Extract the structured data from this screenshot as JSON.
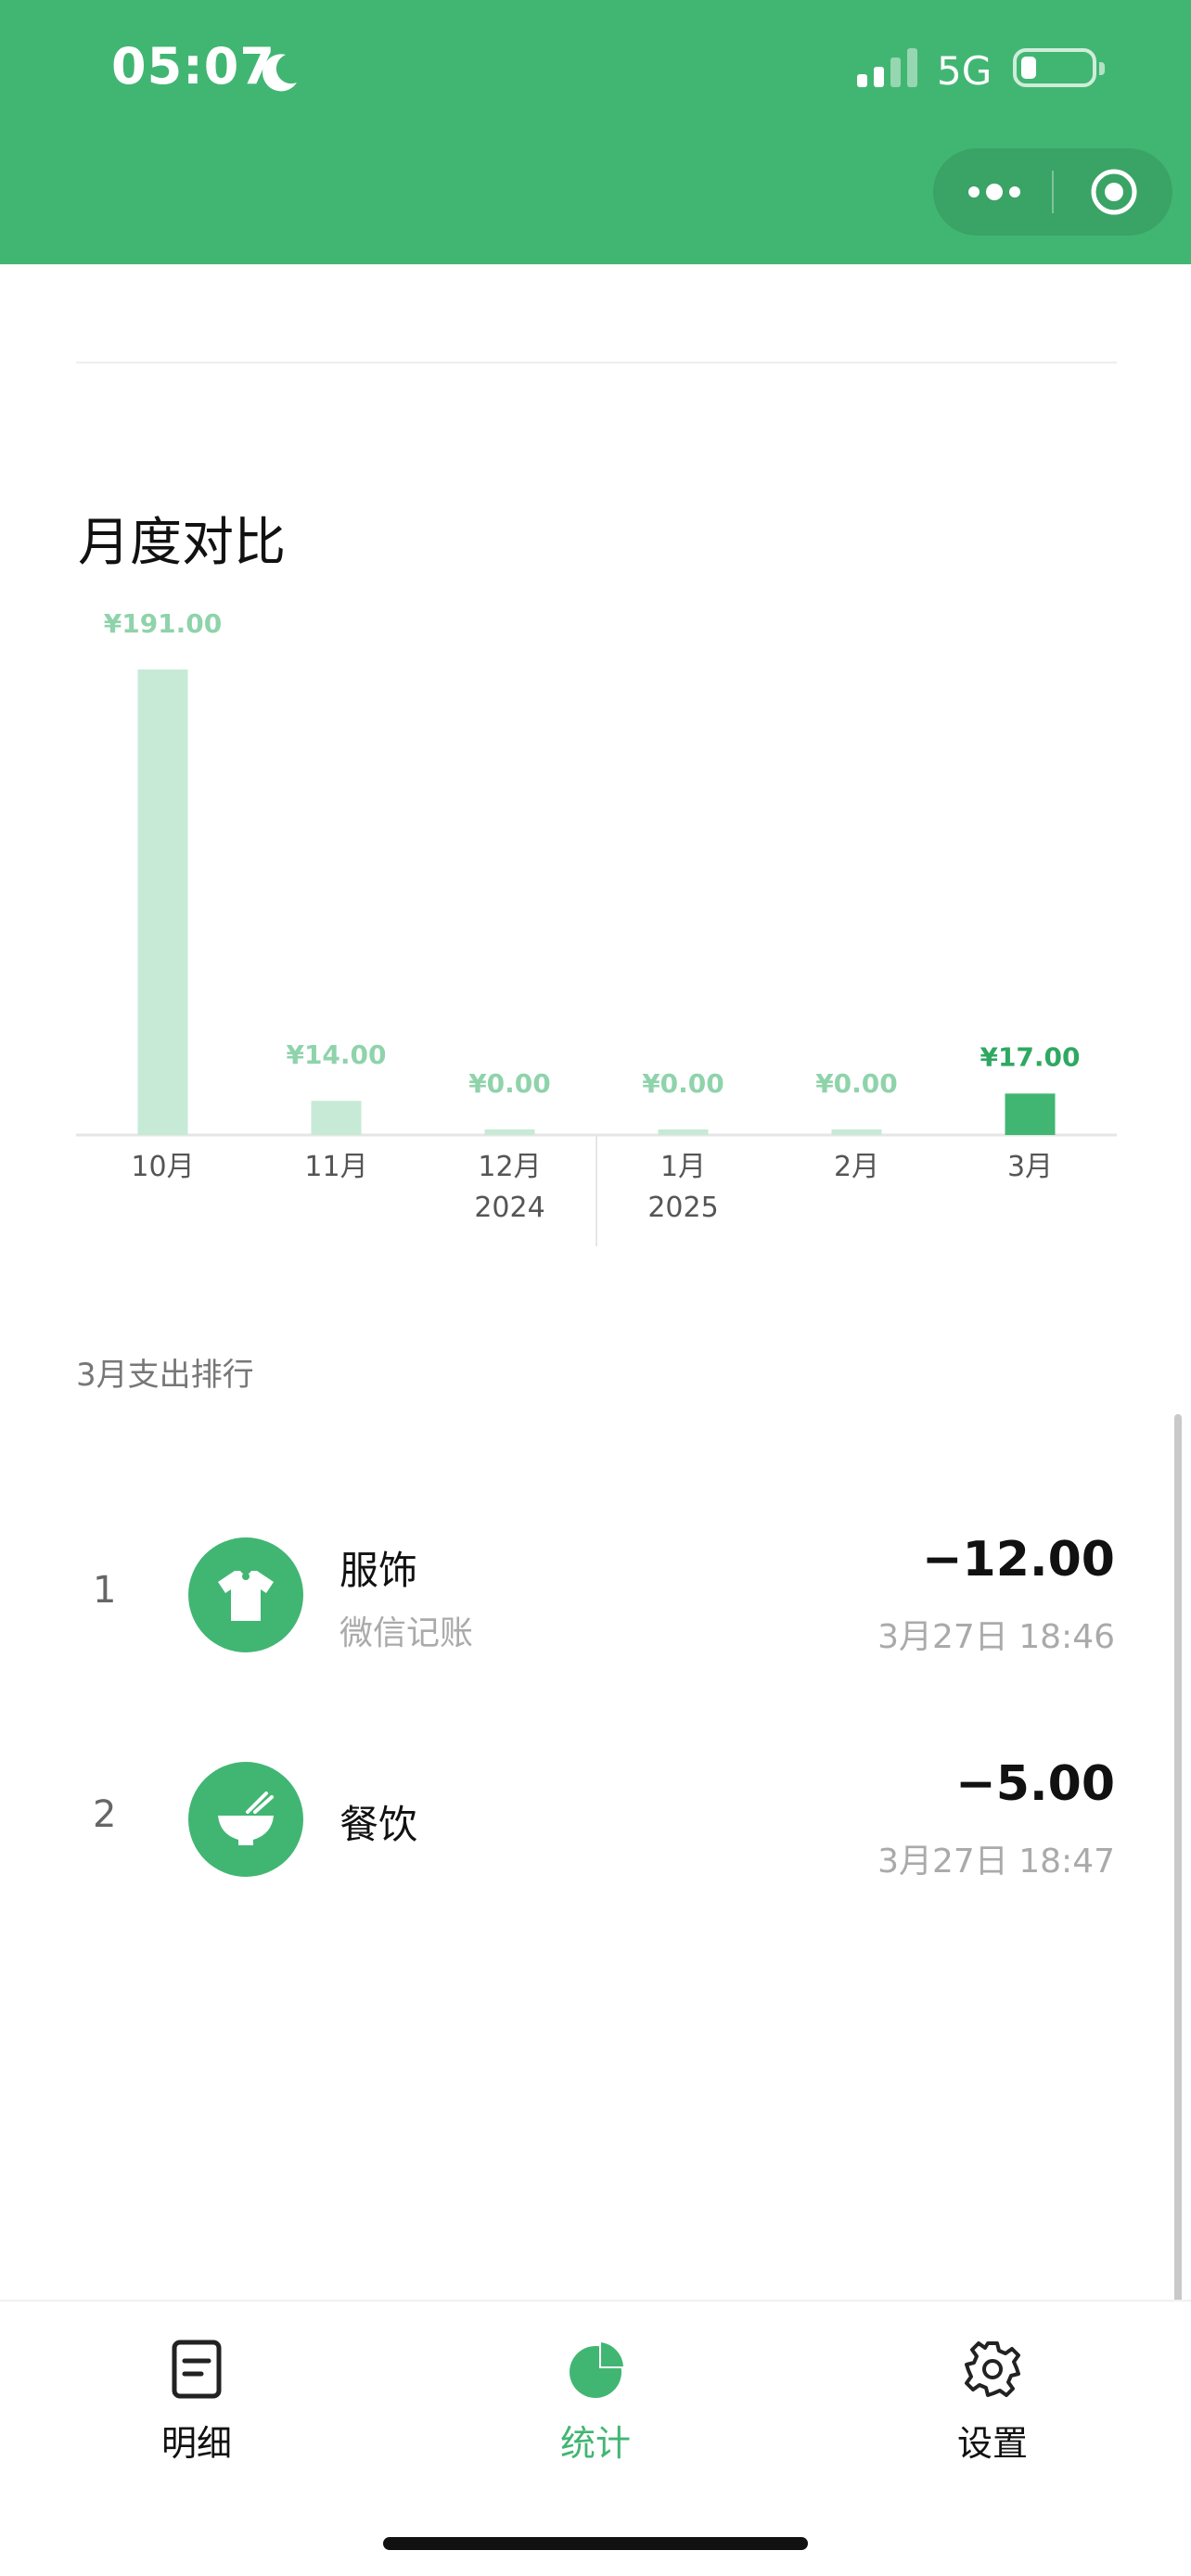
{
  "status_bar": {
    "time": "05:07",
    "network": "5G",
    "icons": [
      "moon-icon",
      "signal-icon",
      "battery-icon"
    ]
  },
  "capsule": {
    "icons": [
      "more-dots-icon",
      "close-target-icon"
    ]
  },
  "monthly": {
    "title": "月度对比"
  },
  "chart_data": {
    "type": "bar",
    "categories": [
      "10月",
      "11月",
      "12月",
      "1月",
      "2月",
      "3月"
    ],
    "sub_labels": [
      "",
      "",
      "2024",
      "2025",
      "",
      ""
    ],
    "values": [
      191.0,
      14.0,
      0.0,
      0.0,
      0.0,
      17.0
    ],
    "value_labels": [
      "¥191.00",
      "¥14.00",
      "¥0.00",
      "¥0.00",
      "¥0.00",
      "¥17.00"
    ],
    "highlight_index": 5,
    "ylim": [
      0,
      191
    ],
    "colors": {
      "bar": "#c6ead6",
      "highlight": "#41b672",
      "value_text": "#8fd3ab",
      "highlight_text": "#2fa862"
    }
  },
  "ranking": {
    "title": "3月支出排行",
    "items": [
      {
        "rank": "1",
        "name": "服饰",
        "note": "微信记账",
        "amount": "−12.00",
        "time": "3月27日 18:46",
        "icon": "tshirt-icon"
      },
      {
        "rank": "2",
        "name": "餐饮",
        "note": "",
        "amount": "−5.00",
        "time": "3月27日 18:47",
        "icon": "bowl-icon"
      }
    ]
  },
  "tabbar": {
    "tabs": [
      {
        "label": "明细",
        "icon": "document-icon",
        "active": false
      },
      {
        "label": "统计",
        "icon": "pie-chart-icon",
        "active": true
      },
      {
        "label": "设置",
        "icon": "gear-icon",
        "active": false
      }
    ]
  },
  "colors": {
    "brand": "#41b672",
    "text": "#111111",
    "muted": "#aaaaaa"
  }
}
